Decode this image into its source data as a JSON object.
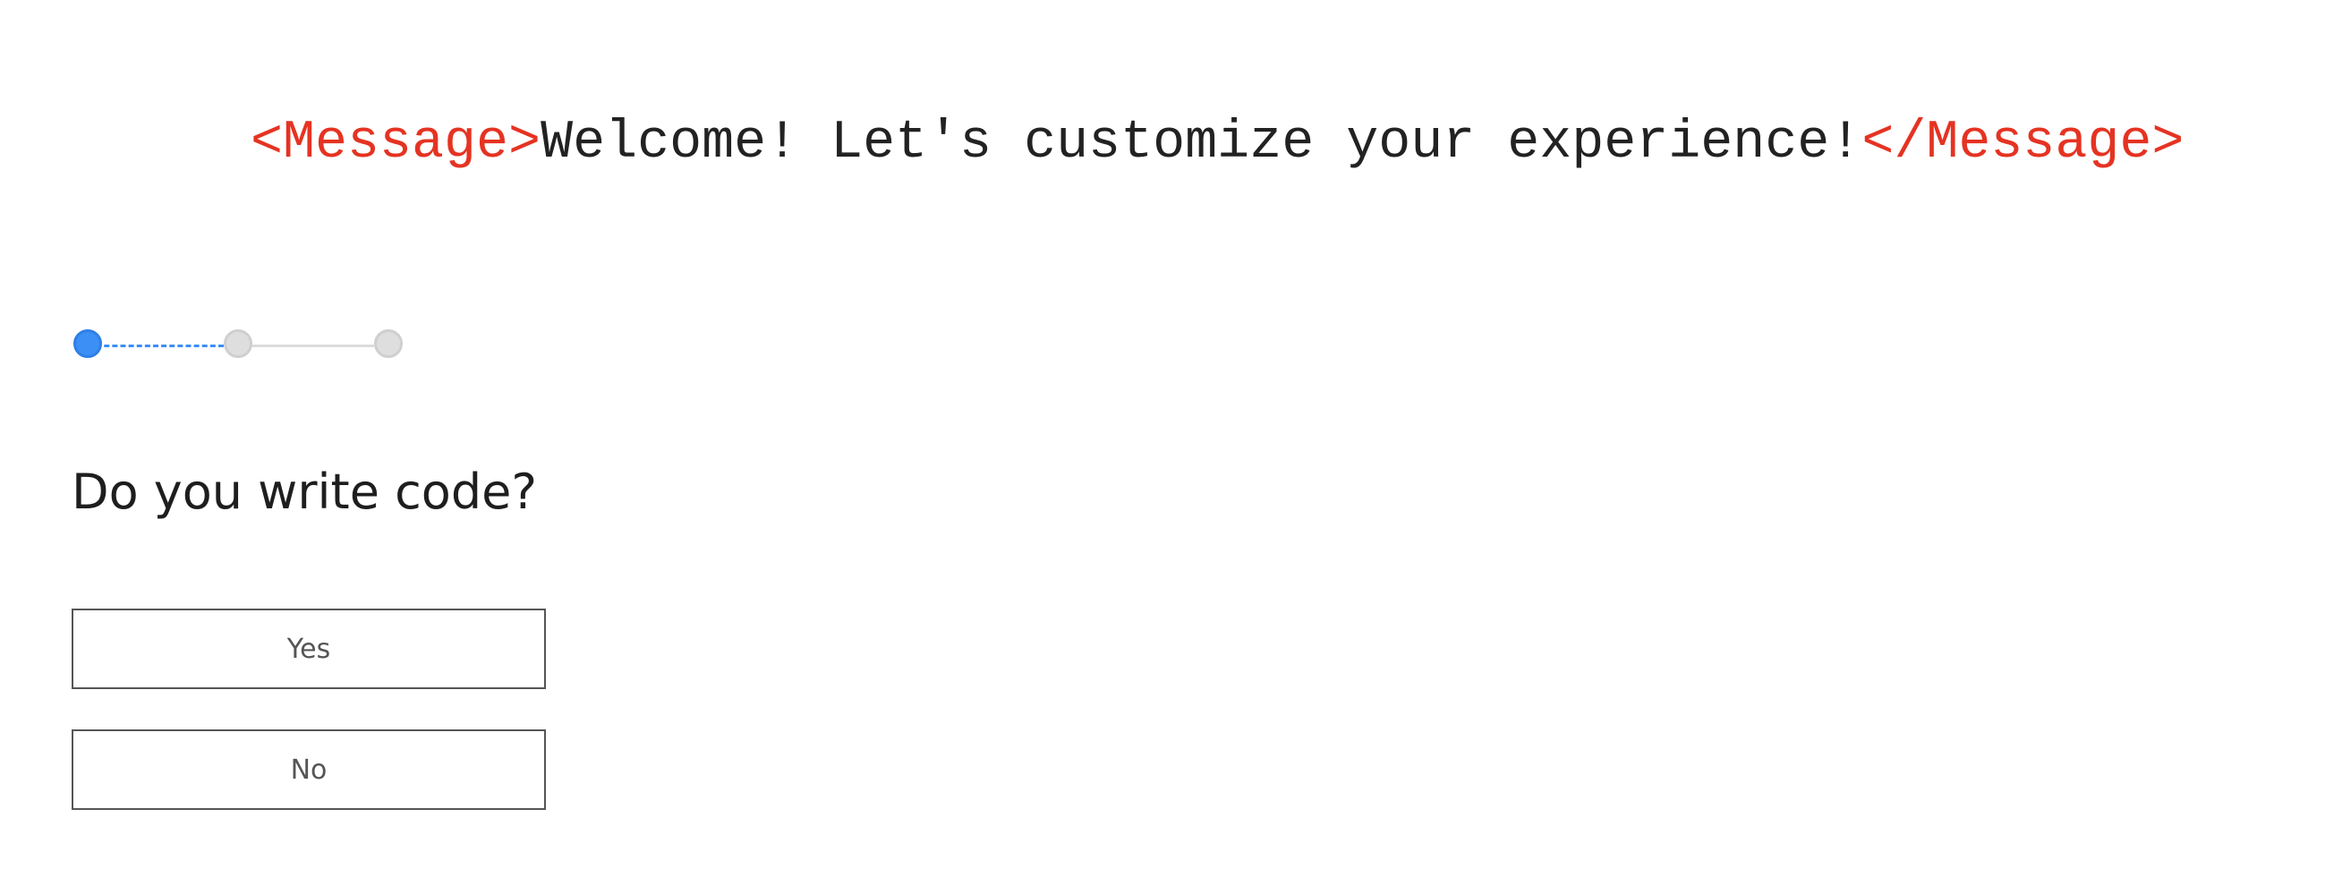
{
  "message": {
    "open_tag": "<Message>",
    "text": "Welcome! Let's customize your experience!",
    "close_tag": "</Message>"
  },
  "stepper": {
    "current_step": 1,
    "total_steps": 3
  },
  "question": {
    "text": "Do you write code?"
  },
  "options": {
    "yes": "Yes",
    "no": "No"
  },
  "colors": {
    "tag": "#e53322",
    "accent": "#3b8ff5",
    "inactive": "#dedede",
    "text": "#1e1e1e"
  }
}
